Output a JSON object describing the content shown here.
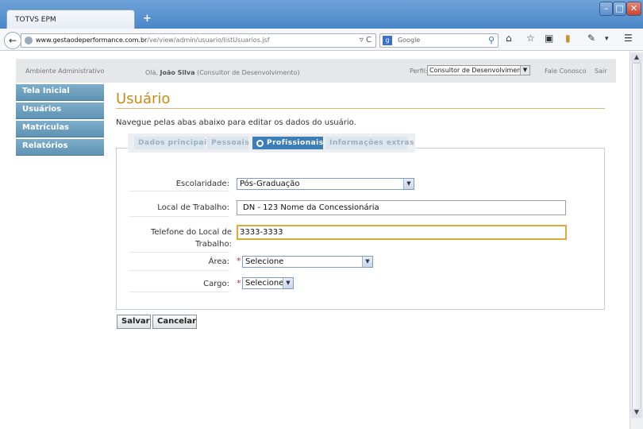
{
  "browser": {
    "tab_title": "TOTVS EPM",
    "new_tab": "+",
    "url_domain": "www.gestaodeperformance.com.br",
    "url_path": "/ve/view/admin/usuario/listUsuarios.jsf",
    "search_placeholder": "Google",
    "search_engine": "g"
  },
  "header": {
    "environment": "Ambiente Administrativo",
    "greeting_prefix": "Olá,",
    "user_name": "João Silva",
    "user_role": "(Consultor de Desenvolvimento)",
    "profile_label": "Perfil:",
    "profile_value": "Consultor de Desenvolvimento",
    "contact": "Fale Conosco",
    "logout": "Sair"
  },
  "sidebar": {
    "items": [
      {
        "label": "Tela Inicial"
      },
      {
        "label": "Usuários"
      },
      {
        "label": "Matrículas"
      },
      {
        "label": "Relatórios"
      }
    ]
  },
  "main": {
    "title": "Usuário",
    "intro": "Navegue pelas abas abaixo para editar os dados do usuário.",
    "tabs": [
      {
        "label": "Dados principais",
        "active": false
      },
      {
        "label": "Pessoais",
        "active": false
      },
      {
        "label": "Profissionais",
        "active": true
      },
      {
        "label": "Informações extras",
        "active": false
      }
    ],
    "form": {
      "escolaridade_label": "Escolaridade:",
      "escolaridade_value": "Pós-Graduação",
      "local_label": "Local de Trabalho:",
      "local_value": "DN - 123 Nome da Concessionária",
      "telefone_label_1": "Telefone do Local de",
      "telefone_label_2": "Trabalho:",
      "telefone_value": "3333-3333",
      "area_label": "Área:",
      "area_value": "Selecione",
      "cargo_label": "Cargo:",
      "cargo_value": "Selecione",
      "required_mark": "*"
    },
    "buttons": {
      "save": "Salvar",
      "cancel": "Cancelar"
    }
  },
  "colors": {
    "accent": "#c88a1a",
    "tab_active": "#3c7fb8",
    "sidebar": "#6a9dbd",
    "focus_border": "#e0a83a",
    "required": "#c0322a"
  }
}
